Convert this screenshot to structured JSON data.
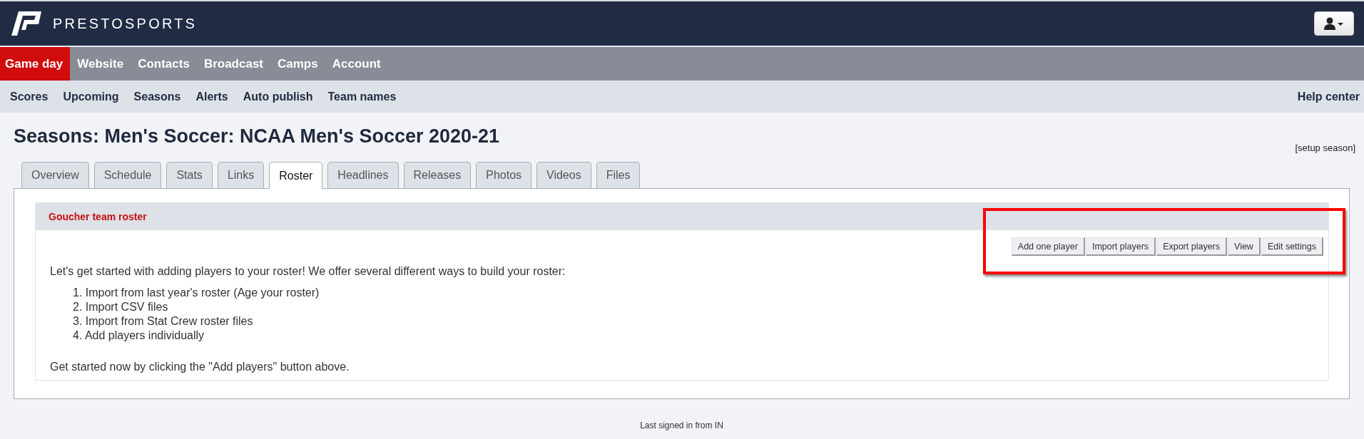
{
  "brand": {
    "name": "PRESTOSPORTS"
  },
  "main_nav": [
    {
      "label": "Game day",
      "selected": true
    },
    {
      "label": "Website",
      "selected": false
    },
    {
      "label": "Contacts",
      "selected": false
    },
    {
      "label": "Broadcast",
      "selected": false
    },
    {
      "label": "Camps",
      "selected": false
    },
    {
      "label": "Account",
      "selected": false
    }
  ],
  "sub_nav": [
    "Scores",
    "Upcoming",
    "Seasons",
    "Alerts",
    "Auto publish",
    "Team names"
  ],
  "help_link": "Help center",
  "page_title": "Seasons: Men's Soccer: NCAA Men's Soccer 2020-21",
  "setup_link": "[setup season]",
  "tabs": [
    {
      "label": "Overview",
      "selected": false
    },
    {
      "label": "Schedule",
      "selected": false
    },
    {
      "label": "Stats",
      "selected": false
    },
    {
      "label": "Links",
      "selected": false
    },
    {
      "label": "Roster",
      "selected": true
    },
    {
      "label": "Headlines",
      "selected": false
    },
    {
      "label": "Releases",
      "selected": false
    },
    {
      "label": "Photos",
      "selected": false
    },
    {
      "label": "Videos",
      "selected": false
    },
    {
      "label": "Files",
      "selected": false
    }
  ],
  "roster_panel": {
    "title": "Goucher team roster",
    "buttons": [
      "Add one player",
      "Import players",
      "Export players",
      "View",
      "Edit settings"
    ],
    "highlighted": true,
    "intro": "Let's get started with adding players to your roster! We offer several different ways to build your roster:",
    "steps": [
      "1. Import from last year's roster (Age your roster)",
      "2. Import CSV files",
      "3. Import from Stat Crew roster files",
      "4. Add players individually"
    ],
    "outro": "Get started now by clicking the \"Add players\" button above."
  },
  "footer": "Last signed in from IN"
}
